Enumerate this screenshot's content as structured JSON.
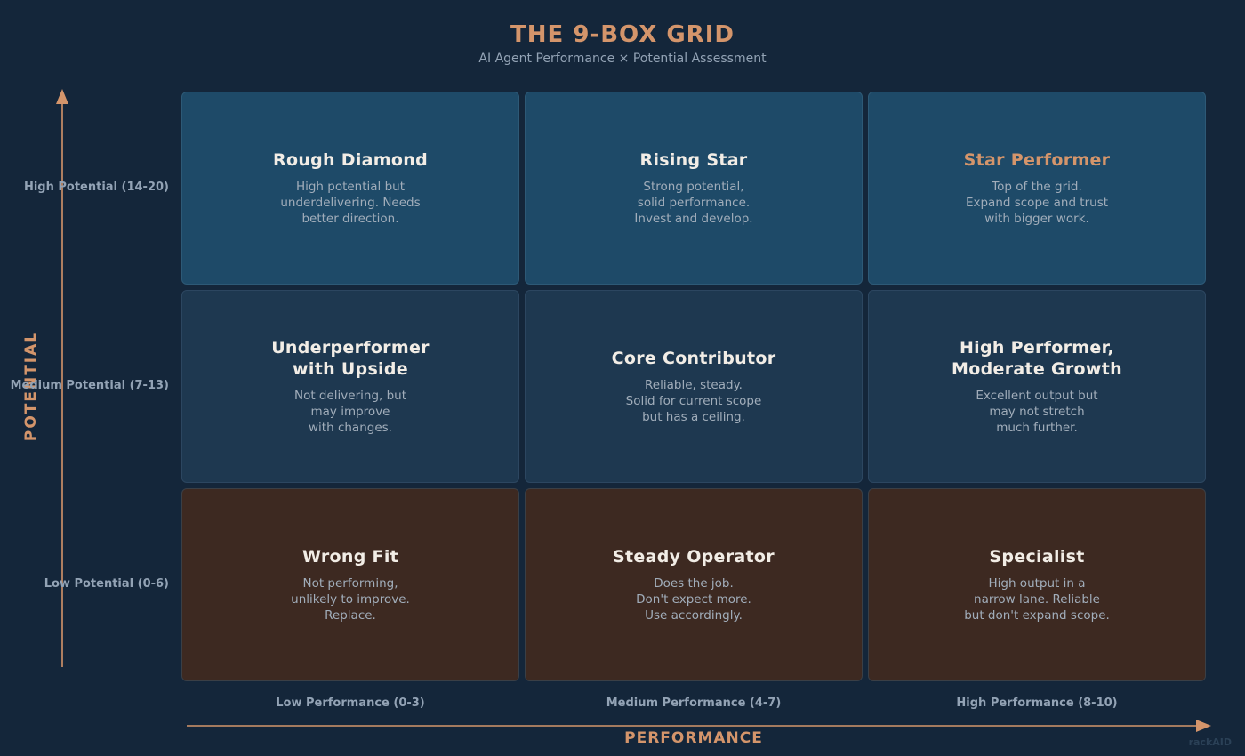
{
  "header": {
    "title": "THE 9-BOX GRID",
    "subtitle": "AI Agent Performance × Potential Assessment"
  },
  "axes": {
    "y_title": "POTENTIAL",
    "x_title": "PERFORMANCE",
    "arrow_color": "#d4956b",
    "rows": [
      "High Potential (14-20)",
      "Medium Potential (7-13)",
      "Low Potential (0-6)"
    ],
    "columns": [
      "Low Performance (0-3)",
      "Medium Performance (4-7)",
      "High Performance (8-10)"
    ]
  },
  "boxes": [
    {
      "title": "Rough Diamond",
      "desc": "High potential but\nunderdelivering. Needs\nbetter direction.",
      "tone": "high",
      "accent": false
    },
    {
      "title": "Rising Star",
      "desc": "Strong potential,\nsolid performance.\nInvest and develop.",
      "tone": "high",
      "accent": false
    },
    {
      "title": "Star Performer",
      "desc": "Top of the grid.\nExpand scope and trust\nwith bigger work.",
      "tone": "high",
      "accent": true
    },
    {
      "title": "Underperformer\nwith Upside",
      "desc": "Not delivering, but\nmay improve\nwith changes.",
      "tone": "mid",
      "accent": false
    },
    {
      "title": "Core Contributor",
      "desc": "Reliable, steady.\nSolid for current scope\nbut has a ceiling.",
      "tone": "mid",
      "accent": false
    },
    {
      "title": "High Performer,\nModerate Growth",
      "desc": "Excellent output but\nmay not stretch\nmuch further.",
      "tone": "mid",
      "accent": false
    },
    {
      "title": "Wrong Fit",
      "desc": "Not performing,\nunlikely to improve.\nReplace.",
      "tone": "low",
      "accent": false
    },
    {
      "title": "Steady Operator",
      "desc": "Does the job.\nDon't expect more.\nUse accordingly.",
      "tone": "low",
      "accent": false
    },
    {
      "title": "Specialist",
      "desc": "High output in a\nnarrow lane. Reliable\nbut don't expand scope.",
      "tone": "low",
      "accent": false
    }
  ],
  "colors": {
    "accent": "#d4956b",
    "high_potential_fill": "#1e4a68",
    "medium_potential_fill": "#1e3850",
    "low_potential_fill": "#3d2921",
    "background": "#14263a"
  },
  "watermark": "rackAID"
}
